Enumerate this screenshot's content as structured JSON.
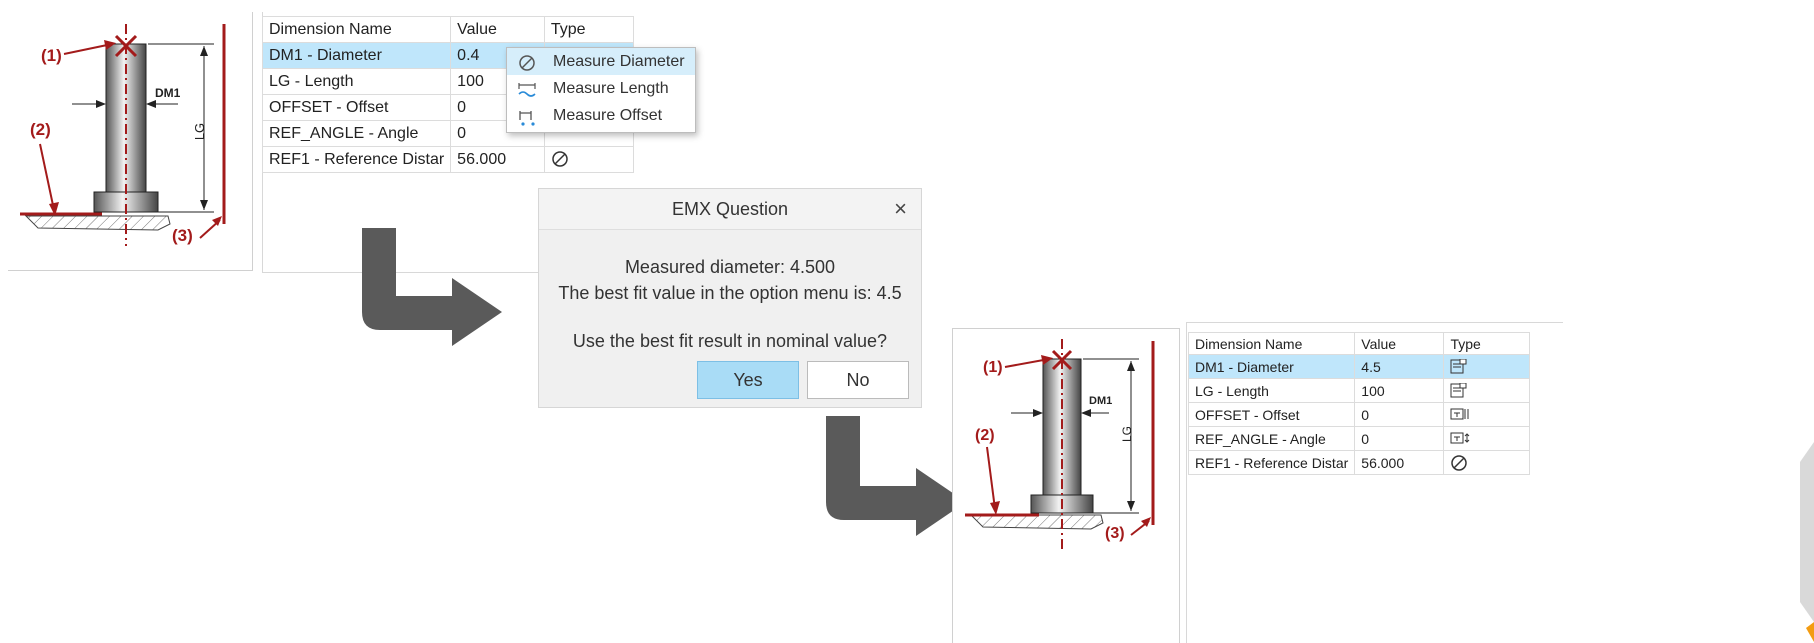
{
  "drawing": {
    "label_1": "(1)",
    "label_2": "(2)",
    "label_3": "(3)",
    "dm1": "DM1",
    "lg": "LG"
  },
  "table": {
    "headers": [
      "Dimension Name",
      "Value",
      "Type"
    ],
    "rows_before": [
      {
        "name": "DM1 - Diameter",
        "value": "0.4"
      },
      {
        "name": "LG - Length",
        "value": "100"
      },
      {
        "name": "OFFSET - Offset",
        "value": "0"
      },
      {
        "name": "REF_ANGLE - Angle",
        "value": "0"
      },
      {
        "name": "REF1 - Reference Distar",
        "value": "56.000"
      }
    ],
    "rows_after": [
      {
        "name": "DM1 - Diameter",
        "value": "4.5"
      },
      {
        "name": "LG - Length",
        "value": "100"
      },
      {
        "name": "OFFSET - Offset",
        "value": "0"
      },
      {
        "name": "REF_ANGLE - Angle",
        "value": "0"
      },
      {
        "name": "REF1 - Reference Distar",
        "value": "56.000"
      }
    ]
  },
  "context_menu": {
    "items": [
      {
        "label": "Measure Diameter",
        "icon": "measure-diameter-icon"
      },
      {
        "label": "Measure Length",
        "icon": "measure-length-icon"
      },
      {
        "label": "Measure Offset",
        "icon": "measure-offset-icon"
      }
    ]
  },
  "dialog": {
    "title": "EMX Question",
    "close": "×",
    "line1": "Measured diameter: 4.500",
    "line2": "The best fit value in the option menu is: 4.5",
    "line3": "Use the best fit result in nominal value?",
    "yes": "Yes",
    "no": "No"
  },
  "colors": {
    "annotation_red": "#a31b1b",
    "selection_blue": "#bfe6fb",
    "arrow_gray": "#5a5a5a",
    "accent_orange": "#f39c12"
  }
}
